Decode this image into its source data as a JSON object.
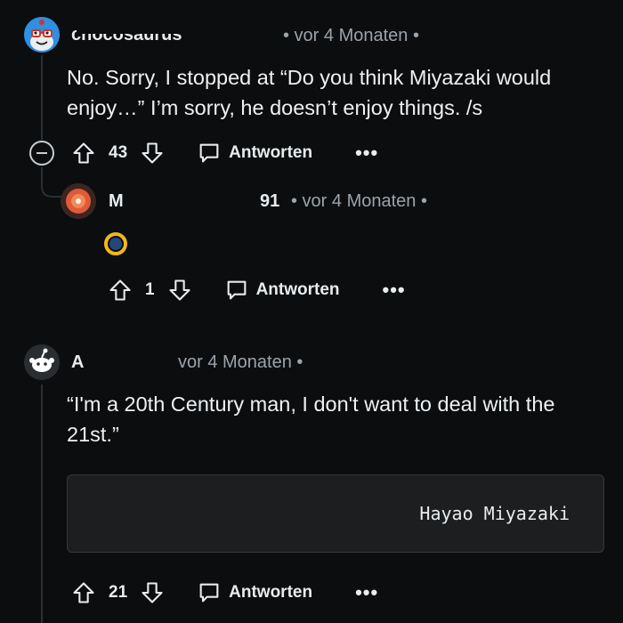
{
  "comment1": {
    "username": "chocosaurus",
    "time": "• vor 4 Monaten •",
    "body_line1": "No. Sorry, I stopped at “Do you think Miyazaki would",
    "body_line2": "enjoy…” I’m sorry, he doesn’t enjoy things. /s",
    "votes": "43",
    "reply_label": "Antworten",
    "more_label": "•••"
  },
  "comment2": {
    "username": "M",
    "username_tail": "91",
    "time": "• vor 4 Monaten •",
    "votes": "1",
    "reply_label": "Antworten",
    "more_label": "•••"
  },
  "comment3": {
    "username": "A",
    "time": "vor 4 Monaten •",
    "body_line1": "“I'm a 20th Century man, I don't want to deal with the",
    "body_line2": "21st.”",
    "quote": "Hayao Miyazaki",
    "votes": "21",
    "reply_label": "Antworten",
    "more_label": "•••"
  },
  "colors": {
    "background": "#0b0d0f",
    "text": "#e8ecee",
    "meta": "#9aa4ab",
    "avatar1": "#2f8fe0",
    "avatar2": "#e05a3a"
  }
}
